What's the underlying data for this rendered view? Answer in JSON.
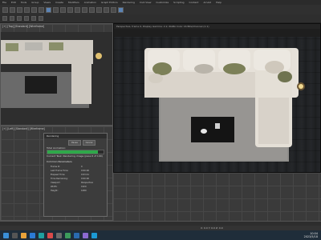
{
  "menu": [
    "File",
    "Edit",
    "Tools",
    "Group",
    "Views",
    "Create",
    "Modifiers",
    "Animation",
    "Graph Editors",
    "Rendering",
    "Civil View",
    "Customize",
    "Scripting",
    "Content",
    "Arnold",
    "Help"
  ],
  "viewports": {
    "top_label": "[+] [Top] [Standard] [Wireframe]",
    "left_label": "[+] [Left] [Standard] [Wireframe]",
    "persp_label": "[+] [Perspective] [Standard] [Default Shading]"
  },
  "render_window": {
    "title": "Perspective, frame 0, Display Gamma: 2.2, RGBA Color 16 Bits/Channel (1:1)"
  },
  "dialog": {
    "title": "Rendering",
    "pause_label": "Pause",
    "cancel_label": "Cancel",
    "status_label": "Total Animation:",
    "current_task": "Current Task: Rendering image (pass 6 of 100)",
    "progress": 0.9,
    "section": "Common Parameters",
    "rows": [
      {
        "k": "Frame #:",
        "v": "0"
      },
      {
        "k": "Last Frame Time:",
        "v": "0:00:00"
      },
      {
        "k": "Elapsed Time:",
        "v": "0:03:41"
      },
      {
        "k": "Time Remaining:",
        "v": "0:00:00"
      },
      {
        "k": "Viewport:",
        "v": "Perspective"
      },
      {
        "k": "Width:",
        "v": "1920"
      },
      {
        "k": "Height:",
        "v": "1080"
      }
    ]
  },
  "status": {
    "coord": "X: 0.0   Y: 0.0   Z: 0.0"
  },
  "taskbar": {
    "time": "10:04",
    "date": "2023/5/18"
  }
}
